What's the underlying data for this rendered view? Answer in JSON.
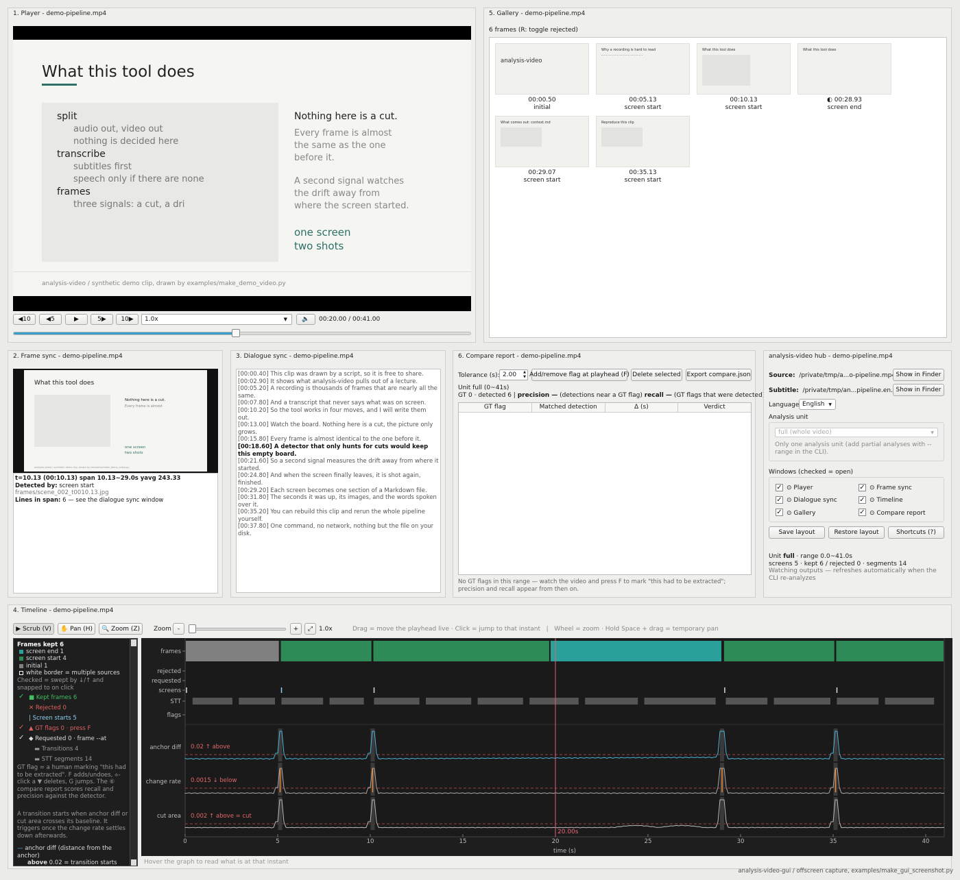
{
  "player": {
    "title": "1. Player - demo-pipeline.mp4",
    "slide_title": "What this tool does",
    "slide_list": [
      {
        "t": "split",
        "sub": [
          "audio out, video out",
          "nothing is decided here"
        ]
      },
      {
        "t": "transcribe",
        "sub": [
          "subtitles first",
          "speech only if there are none"
        ]
      },
      {
        "t": "frames",
        "sub": [
          "three signals: a cut, a dri"
        ]
      }
    ],
    "right_heading": "Nothing here is a cut.",
    "right_p1": [
      "Every frame is almost",
      "the same as the one",
      "before it."
    ],
    "right_p2": [
      "A second signal watches",
      "the drift away from",
      "where the screen started."
    ],
    "right_accent": [
      "one screen",
      "two shots"
    ],
    "footer": "analysis-video / synthetic demo clip, drawn by examples/make_demo_video.py",
    "buttons": {
      "back10": "◀10",
      "back5": "◀5",
      "play": "▶",
      "fwd5": "5▶",
      "fwd10": "10▶",
      "mute": "🔈"
    },
    "speed": "1.0x",
    "time": "00:20.00 / 00:41.00",
    "progress": 0.487
  },
  "gallery": {
    "title": "5. Gallery - demo-pipeline.mp4",
    "subtitle": "6 frames (R: toggle rejected)",
    "items": [
      {
        "time": "00:00.50",
        "tag": "initial",
        "head": "analysis-video"
      },
      {
        "time": "00:05.13",
        "tag": "screen start",
        "head": "Why a recording is hard to read"
      },
      {
        "time": "00:10.13",
        "tag": "screen start",
        "head": "What this tool does"
      },
      {
        "time": "◐ 00:28.93",
        "tag": "screen end",
        "head": "What this tool does"
      },
      {
        "time": "00:29.07",
        "tag": "screen start",
        "head": "What comes out: context.md"
      },
      {
        "time": "00:35.13",
        "tag": "screen start",
        "head": "Reproduce this clip"
      }
    ]
  },
  "framesync": {
    "title": "2. Frame sync - demo-pipeline.mp4",
    "thumb_title": "What this tool does",
    "thumb_heading": "Nothing here is a cut.",
    "line1": "t=10.13 (00:10.13)   span 10.13~29.0s   yavg 243.33",
    "detected_label": "Detected by:",
    "detected": " screen start",
    "path": "frames/scene_002_t0010.13.jpg",
    "lines_label": "Lines in span:",
    "lines": " 6 — see the dialogue sync window"
  },
  "dialogue": {
    "title": "3. Dialogue sync - demo-pipeline.mp4",
    "lines": [
      {
        "t": "[00:00.40] This clip was drawn by a script, so it is free to share.",
        "b": false
      },
      {
        "t": "[00:02.90] It shows what analysis-video pulls out of a lecture.",
        "b": false
      },
      {
        "t": "[00:05.20] A recording is thousands of frames that are nearly all the same.",
        "b": false
      },
      {
        "t": "[00:07.80] And a transcript that never says what was on screen.",
        "b": false
      },
      {
        "t": "[00:10.20] So the tool works in four moves, and I will write them out.",
        "b": false
      },
      {
        "t": "[00:13.00] Watch the board. Nothing here is a cut, the picture only grows.",
        "b": false
      },
      {
        "t": "[00:15.80] Every frame is almost identical to the one before it.",
        "b": false
      },
      {
        "t": "[00:18.60] A detector that only hunts for cuts would keep this empty board.",
        "b": true
      },
      {
        "t": "[00:21.60] So a second signal measures the drift away from where it started.",
        "b": false
      },
      {
        "t": "[00:24.80] And when the screen finally leaves, it is shot again, finished.",
        "b": false
      },
      {
        "t": "[00:29.20] Each screen becomes one section of a Markdown file.",
        "b": false
      },
      {
        "t": "[00:31.80] The seconds it was up, its images, and the words spoken over it.",
        "b": false
      },
      {
        "t": "[00:35.20] You can rebuild this clip and rerun the whole pipeline yourself.",
        "b": false
      },
      {
        "t": "[00:37.80] One command, no network, nothing but the file on your disk.",
        "b": false
      }
    ]
  },
  "compare": {
    "title": "6. Compare report - demo-pipeline.mp4",
    "tolerance_label": "Tolerance (s):",
    "tolerance": "2.00",
    "btn_flag": "Add/remove flag at playhead (F)",
    "btn_delete": "Delete selected",
    "btn_export": "Export compare.json",
    "unit": "Unit full (0~41s)",
    "stats_prefix": "GT 0 · detected 6  |  ",
    "precision": "precision —",
    "precision_note": " (detections near a GT flag)  ",
    "recall": "recall —",
    "recall_note": " (GT flags that were detected)",
    "cols": [
      "GT flag",
      "Matched detection",
      "Δ (s)",
      "Verdict"
    ],
    "note": "No GT flags in this range — watch the video and press F to mark \"this had to be extracted\"; precision and recall appear from then on."
  },
  "hub": {
    "title": "analysis-video hub - demo-pipeline.mp4",
    "source_label": "Source:",
    "source": "/private/tmp/a...o-pipeline.mp4",
    "subtitle_label": "Subtitle:",
    "subtitle": "/private/tmp/an...pipeline.en.srt",
    "finder": "Show in Finder",
    "language_label": "Language",
    "language": "English",
    "unit_label": "Analysis unit",
    "unit_select": "full  (whole video)",
    "unit_note": "Only one analysis unit (add partial analyses with --range in the CLI).",
    "windows_label": "Windows (checked = open)",
    "windows": [
      "⊙ Player",
      "⊙ Frame sync",
      "⊙ Dialogue sync",
      "⊙ Timeline",
      "⊙ Gallery",
      "⊙ Compare report"
    ],
    "save": "Save layout",
    "restore": "Restore layout",
    "shortcuts": "Shortcuts (?)",
    "status_unit": "Unit ",
    "status_full": "full",
    "status_rest": " · range 0.0~41.0s",
    "status2": "screens 5 · kept 6 / rejected 0 · segments 14",
    "status3": "Watching outputs — refreshes automatically when the CLI re-analyzes"
  },
  "timeline": {
    "title": "4. Timeline - demo-pipeline.mp4",
    "scrub": "▶ Scrub (V)",
    "pan": "✋ Pan (H)",
    "zoom": "🔍 Zoom (Z)",
    "zoom_label": "Zoom",
    "zoom_minus": "-",
    "zoom_plus": "+",
    "zoom_fit": "⤢",
    "zoom_value": "1.0x",
    "hint": "Drag = move the playhead live · Click = jump to that instant   |   Wheel = zoom · Hold Space + drag = temporary pan",
    "legend": {
      "kept_head": "Frames kept 6",
      "end": "screen end 1",
      "start": "screen start 4",
      "initial": "initial 1",
      "white": "white border = multiple sources",
      "checked_note": "Checked = swept by ↓/↑ and snapped to on click",
      "kept": "Kept frames 6",
      "rejected": "Rejected 0",
      "screen_starts": "Screen starts 5",
      "gt": "GT flags 0 · press F",
      "requested": "Requested 0 · frame --at",
      "transitions": "Transitions 4",
      "stt": "STT segments 14",
      "gt_note": "GT flag = a human marking \"this had to be extracted\". F adds/undoes, ⟡-click a ▼ deletes, G jumps. The ⑥ compare report scores recall and precision against the detector.",
      "trans_note": "A transition starts when anchor diff or cut area crosses its baseline. It triggers once the change rate settles down afterwards.",
      "anchor_note": "anchor diff (distance from the anchor)",
      "above_bold": "above",
      "above_note": " 0.02 = transition starts"
    },
    "lanes": [
      "frames",
      "rejected",
      "requested",
      "screens",
      "STT",
      "flags"
    ],
    "graph_labels": [
      "anchor diff",
      "change rate",
      "cut area"
    ],
    "thresholds": [
      "0.02 ↑ above",
      "0.0015 ↓ below",
      "0.002 ↑ above = cut"
    ],
    "playhead": "20.00s",
    "xlabel": "time (s)",
    "xticks": [
      0,
      5,
      10,
      15,
      20,
      25,
      30,
      35,
      40
    ],
    "duration": 41,
    "playhead_t": 20,
    "frames_segments": [
      {
        "s": 0.0,
        "e": 5.1,
        "k": "gray"
      },
      {
        "s": 5.13,
        "e": 10.1,
        "k": "green"
      },
      {
        "s": 10.13,
        "e": 19.7,
        "k": "green"
      },
      {
        "s": 19.7,
        "e": 29.0,
        "k": "teal"
      },
      {
        "s": 29.07,
        "e": 35.1,
        "k": "green"
      },
      {
        "s": 35.13,
        "e": 41.0,
        "k": "green"
      }
    ],
    "screens_ticks": [
      0,
      5.13,
      10.13,
      29.07,
      35.13
    ],
    "stt": [
      [
        0.4,
        2.7
      ],
      [
        2.9,
        5.0
      ],
      [
        5.2,
        7.6
      ],
      [
        7.8,
        9.8
      ],
      [
        10.2,
        12.8
      ],
      [
        13.0,
        15.6
      ],
      [
        15.8,
        18.4
      ],
      [
        18.6,
        21.4
      ],
      [
        21.6,
        24.6
      ],
      [
        24.8,
        28.8
      ],
      [
        29.2,
        31.6
      ],
      [
        31.8,
        35.0
      ],
      [
        35.2,
        37.6
      ],
      [
        37.8,
        40.6
      ]
    ],
    "spikes": [
      5.13,
      10.13,
      29.0,
      35.13
    ],
    "status": "Hover the graph to read what is at that instant"
  },
  "footer": "analysis-video-gui / offscreen capture, examples/make_gui_screenshot.py",
  "colors": {
    "green": "#2e8b57",
    "teal": "#2aa09a",
    "gray": "#808080",
    "red": "#e06060",
    "cyan": "#4fb3d9"
  }
}
